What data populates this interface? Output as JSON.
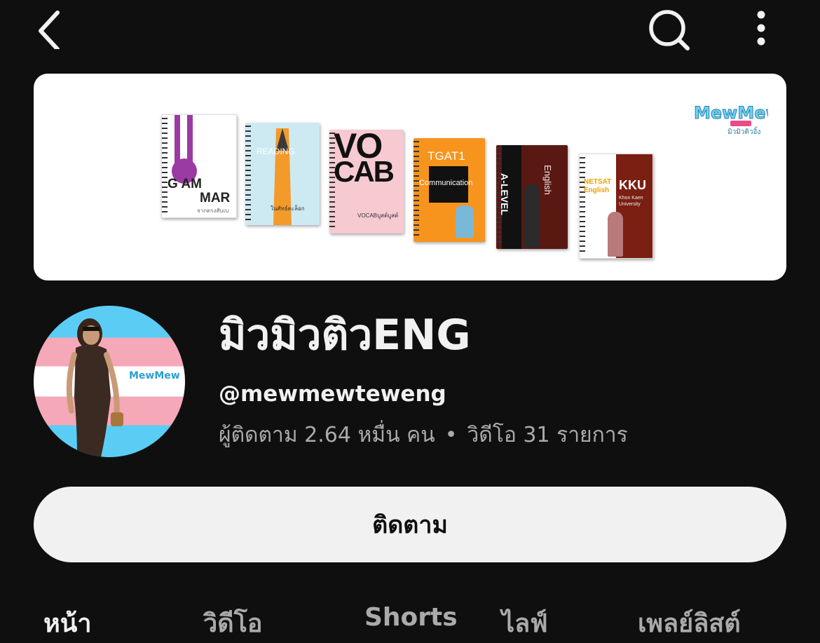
{
  "header": {
    "back_icon": "chevron-left-icon",
    "search_icon": "search-icon",
    "more_icon": "more-vertical-icon"
  },
  "banner": {
    "books": [
      {
        "title_line1": "G AM",
        "title_line2": "MAR",
        "subtitle": "จากตรงสับเบ"
      },
      {
        "title": "READING",
        "subtitle": "ในศัทธ์ตะล็อก"
      },
      {
        "title_line1": "VO",
        "title_line2": "CAB",
        "subtitle": "VOCABบูสต์บูสต์"
      },
      {
        "title": "TGAT1",
        "subtitle": "Communication"
      },
      {
        "title": "A-LEVEL",
        "subtitle": "English"
      },
      {
        "title": "NETSAT English",
        "subtitle": "KKU",
        "caption": "Khon Kaen University"
      }
    ],
    "brand_logo": "MewMew",
    "brand_caption": "มิวมิวติวอิ้ง"
  },
  "channel": {
    "name": "มิวมิวติวENG",
    "handle": "@mewmewteweng",
    "subscribers": "ผู้ติดตาม 2.64 หมื่น คน",
    "separator": "•",
    "videos": "วิดีโอ 31 รายการ",
    "avatar_logo": "MewMew"
  },
  "subscribe_button": {
    "label": "ติดตาม"
  },
  "tabs": [
    {
      "label": "หน้า"
    },
    {
      "label": "วิดีโอ"
    },
    {
      "label": "Shorts"
    },
    {
      "label": "ไลฟ์"
    },
    {
      "label": "เพลย์ลิสต์"
    }
  ],
  "colors": {
    "background": "#0f0f0f",
    "text": "#f1f1f1",
    "secondary_text": "#aaaaaa",
    "button_bg": "#f1f1f1"
  }
}
